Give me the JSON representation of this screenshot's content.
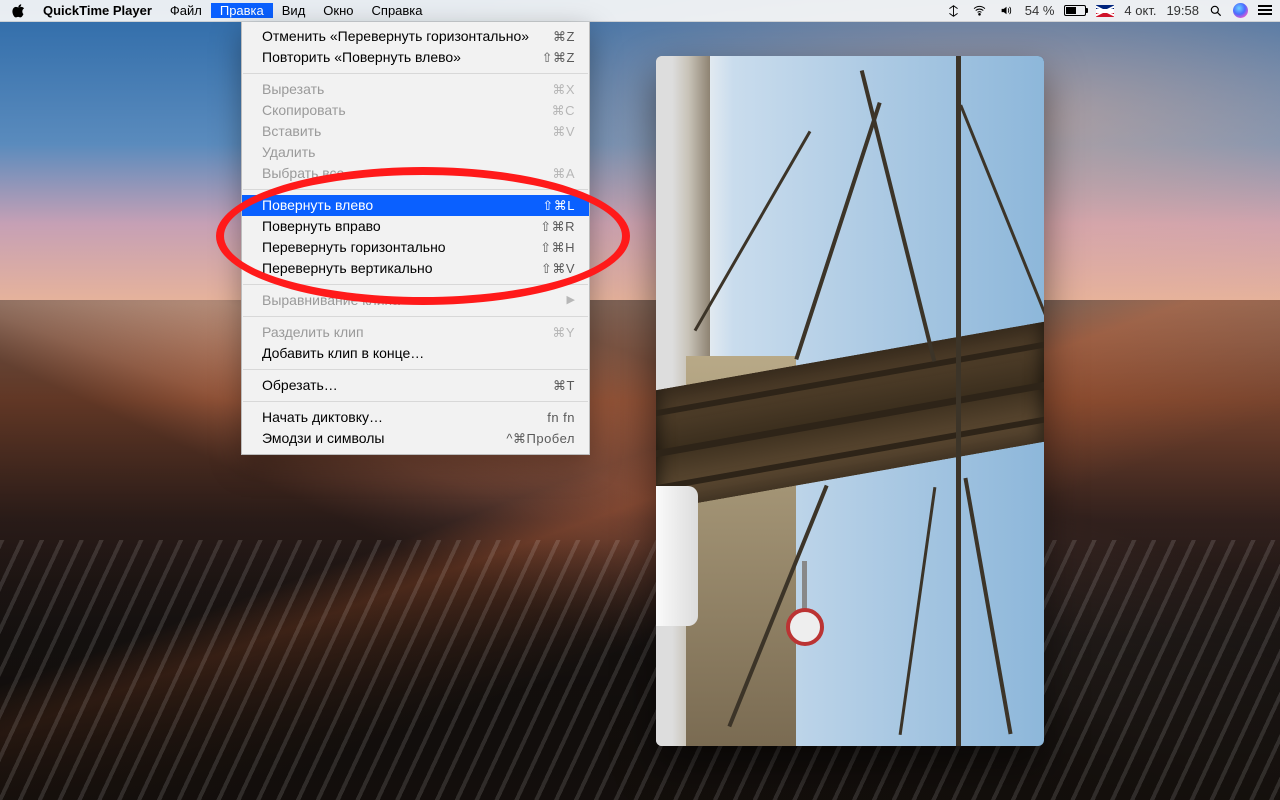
{
  "menubar": {
    "app_name": "QuickTime Player",
    "items": [
      {
        "label": "Файл",
        "active": false
      },
      {
        "label": "Правка",
        "active": true
      },
      {
        "label": "Вид",
        "active": false
      },
      {
        "label": "Окно",
        "active": false
      },
      {
        "label": "Справка",
        "active": false
      }
    ],
    "status": {
      "battery_pct_text": "54 %",
      "battery_pct": 54,
      "lang_code": "GB",
      "date": "4 окт.",
      "time": "19:58"
    }
  },
  "dropdown": {
    "title_menu": "Правка",
    "items": [
      {
        "kind": "item",
        "label": "Отменить «Перевернуть горизонтально»",
        "shortcut": "⌘Z",
        "disabled": false
      },
      {
        "kind": "item",
        "label": "Повторить «Повернуть влево»",
        "shortcut": "⇧⌘Z",
        "disabled": false
      },
      {
        "kind": "sep"
      },
      {
        "kind": "item",
        "label": "Вырезать",
        "shortcut": "⌘X",
        "disabled": true
      },
      {
        "kind": "item",
        "label": "Скопировать",
        "shortcut": "⌘C",
        "disabled": true
      },
      {
        "kind": "item",
        "label": "Вставить",
        "shortcut": "⌘V",
        "disabled": true
      },
      {
        "kind": "item",
        "label": "Удалить",
        "shortcut": "",
        "disabled": true
      },
      {
        "kind": "item",
        "label": "Выбрать все",
        "shortcut": "⌘A",
        "disabled": true
      },
      {
        "kind": "sep"
      },
      {
        "kind": "item",
        "label": "Повернуть влево",
        "shortcut": "⇧⌘L",
        "disabled": false,
        "highlight": true
      },
      {
        "kind": "item",
        "label": "Повернуть вправо",
        "shortcut": "⇧⌘R",
        "disabled": false
      },
      {
        "kind": "item",
        "label": "Перевернуть горизонтально",
        "shortcut": "⇧⌘H",
        "disabled": false
      },
      {
        "kind": "item",
        "label": "Перевернуть вертикально",
        "shortcut": "⇧⌘V",
        "disabled": false
      },
      {
        "kind": "sep"
      },
      {
        "kind": "submenu",
        "label": "Выравнивание клипа",
        "disabled": true
      },
      {
        "kind": "sep"
      },
      {
        "kind": "item",
        "label": "Разделить клип",
        "shortcut": "⌘Y",
        "disabled": true
      },
      {
        "kind": "item",
        "label": "Добавить клип в конце…",
        "shortcut": "",
        "disabled": false
      },
      {
        "kind": "sep"
      },
      {
        "kind": "item",
        "label": "Обрезать…",
        "shortcut": "⌘T",
        "disabled": false
      },
      {
        "kind": "sep"
      },
      {
        "kind": "item",
        "label": "Начать диктовку…",
        "shortcut": "fn fn",
        "disabled": false
      },
      {
        "kind": "item",
        "label": "Эмодзи и символы",
        "shortcut": "^⌘Пробел",
        "disabled": false
      }
    ]
  },
  "annotation": {
    "highlights_items": [
      "Повернуть влево",
      "Повернуть вправо",
      "Перевернуть горизонтально",
      "Перевернуть вертикально"
    ]
  }
}
